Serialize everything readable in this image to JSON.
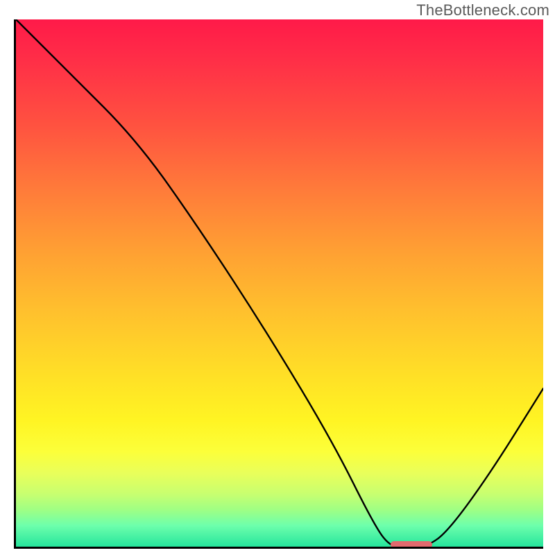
{
  "watermark": "TheBottleneck.com",
  "chart_data": {
    "type": "line",
    "title": "",
    "xlabel": "",
    "ylabel": "",
    "xlim": [
      0,
      100
    ],
    "ylim": [
      0,
      100
    ],
    "series": [
      {
        "name": "curve",
        "x": [
          0,
          10,
          23,
          35,
          48,
          60,
          68,
          71,
          74,
          78,
          82,
          90,
          100
        ],
        "y": [
          100,
          90,
          77,
          60,
          40,
          20,
          4,
          0,
          0,
          0,
          3,
          14,
          30
        ]
      }
    ],
    "marker": {
      "x_start": 71,
      "x_end": 79,
      "y": 0
    },
    "background_gradient": {
      "top": "#ff1a49",
      "mid": "#ffe126",
      "bottom": "#26e59c"
    },
    "axes": {
      "color": "#000000",
      "left": true,
      "bottom": true,
      "ticks": false
    }
  },
  "colors": {
    "watermark": "#5a5a5a",
    "marker": "#e26a6e",
    "curve": "#000000"
  }
}
